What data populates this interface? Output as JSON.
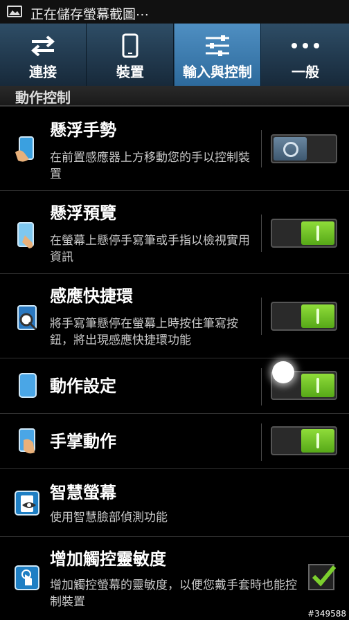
{
  "status_bar": {
    "text": "正在儲存螢幕截圖⋯"
  },
  "tabs": [
    {
      "label": "連接",
      "icon": "swap-arrows-icon",
      "active": false
    },
    {
      "label": "裝置",
      "icon": "phone-icon",
      "active": false
    },
    {
      "label": "輸入與控制",
      "icon": "sliders-icon",
      "active": true
    },
    {
      "label": "一般",
      "icon": "more-dots-icon",
      "active": false
    }
  ],
  "section": {
    "title": "動作控制"
  },
  "settings": [
    {
      "title": "懸浮手勢",
      "desc": "在前置感應器上方移動您的手以控制裝置",
      "control": "toggle",
      "state": "off"
    },
    {
      "title": "懸浮預覽",
      "desc": "在螢幕上懸停手寫筆或手指以檢視實用資訊",
      "control": "toggle",
      "state": "on"
    },
    {
      "title": "感應快捷環",
      "desc": "將手寫筆懸停在螢幕上時按住筆寫按鈕，將出現感應快捷環功能",
      "control": "toggle",
      "state": "on"
    },
    {
      "title": "動作設定",
      "desc": "",
      "control": "toggle",
      "state": "on"
    },
    {
      "title": "手掌動作",
      "desc": "",
      "control": "toggle",
      "state": "on"
    },
    {
      "title": "智慧螢幕",
      "desc": "使用智慧臉部偵測功能",
      "control": "none",
      "state": ""
    },
    {
      "title": "增加觸控靈敏度",
      "desc": "增加觸控螢幕的靈敏度，以便您戴手套時也能控制裝置",
      "control": "checkbox",
      "state": "checked"
    }
  ],
  "watermark": "#349588",
  "colors": {
    "accent_tab": "#3d7fb3",
    "toggle_on": "#76c82a",
    "toggle_off": "#4e6b85"
  }
}
